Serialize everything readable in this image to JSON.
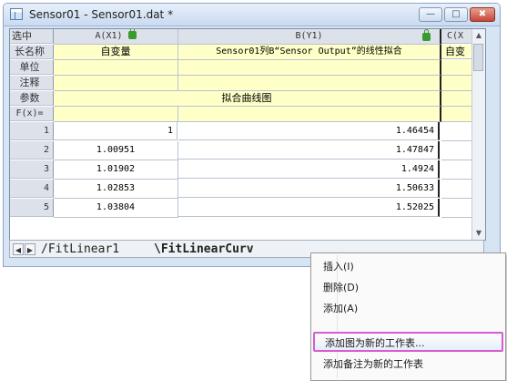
{
  "window": {
    "title": "Sensor01 - Sensor01.dat *",
    "minimize_label": "—",
    "maximize_label": "□",
    "close_label": "✖"
  },
  "grid": {
    "corner": "选中",
    "col_headers": [
      "A(X1)",
      "B(Y1)",
      "C(X"
    ],
    "param_rows": [
      {
        "label": "长名称",
        "a": "自变量",
        "b": "Sensor01列B“Sensor Output”的线性拟合",
        "c": "自变"
      },
      {
        "label": "单位",
        "a": "",
        "b": "",
        "c": ""
      },
      {
        "label": "注释",
        "a": "",
        "b": "",
        "c": ""
      },
      {
        "label": "参数",
        "a": "",
        "b": "拟合曲线图",
        "c": ""
      },
      {
        "label": "F(x)=",
        "a": "",
        "b": "",
        "c": ""
      }
    ],
    "data_rows": [
      {
        "n": "1",
        "a": "1",
        "b": "1.46454"
      },
      {
        "n": "2",
        "a": "1.00951",
        "b": "1.47847"
      },
      {
        "n": "3",
        "a": "1.01902",
        "b": "1.4924"
      },
      {
        "n": "4",
        "a": "1.02853",
        "b": "1.50633"
      },
      {
        "n": "5",
        "a": "1.03804",
        "b": "1.52025"
      }
    ]
  },
  "sheet_tabs": {
    "tabs": [
      "FitLinear1",
      "FitLinearCurv"
    ],
    "active": 1
  },
  "context_menu": {
    "items": [
      "插入(I)",
      "删除(D)",
      "添加(A)",
      "添加图为新的工作表...",
      "添加备注为新的工作表"
    ],
    "highlighted_index": 3
  },
  "colors": {
    "param_row_bg": "#ffffc8",
    "highlight_border": "#d65cd4",
    "lock_icon": "#3b9a2f"
  }
}
